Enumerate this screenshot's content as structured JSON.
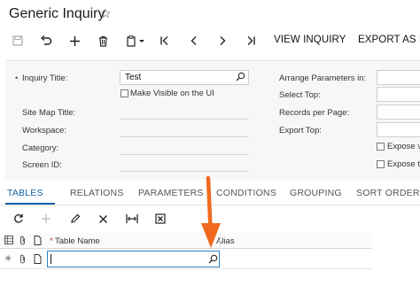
{
  "header": {
    "title": "Generic Inquiry",
    "favorite_icon": "star-outline-icon"
  },
  "toolbar": {
    "icons": [
      "save-icon",
      "undo-icon",
      "add-icon",
      "delete-icon",
      "copy-paste-icon",
      "first-record-icon",
      "previous-record-icon",
      "next-record-icon",
      "last-record-icon"
    ],
    "view_inquiry": "VIEW INQUIRY",
    "export_as": "EXPORT AS R"
  },
  "form": {
    "inquiry_title_label": "Inquiry Title:",
    "inquiry_title_value": "Test",
    "make_visible_label": "Make Visible on the UI",
    "site_map_title_label": "Site Map Title:",
    "workspace_label": "Workspace:",
    "category_label": "Category:",
    "screen_id_label": "Screen ID:",
    "arrange_parameters_label": "Arrange Parameters in:",
    "select_top_label": "Select Top:",
    "records_per_page_label": "Records per Page:",
    "export_top_label": "Export Top:",
    "expose_1_label": "Expose v",
    "expose_2_label": "Expose t"
  },
  "tabs": [
    "TABLES",
    "RELATIONS",
    "PARAMETERS",
    "CONDITIONS",
    "GROUPING",
    "SORT ORDER"
  ],
  "grid": {
    "toolbar_icons": [
      "refresh-icon",
      "add-row-icon",
      "edit-icon",
      "delete-row-icon",
      "fit-columns-icon",
      "export-excel-icon"
    ],
    "columns": {
      "table_name": "Table Name",
      "alias": "Alias",
      "required_marker": "*"
    }
  },
  "annotation": {
    "color": "#f06a1d"
  },
  "colors": {
    "accent": "#1565a8",
    "input_focus": "#2e86d1"
  }
}
